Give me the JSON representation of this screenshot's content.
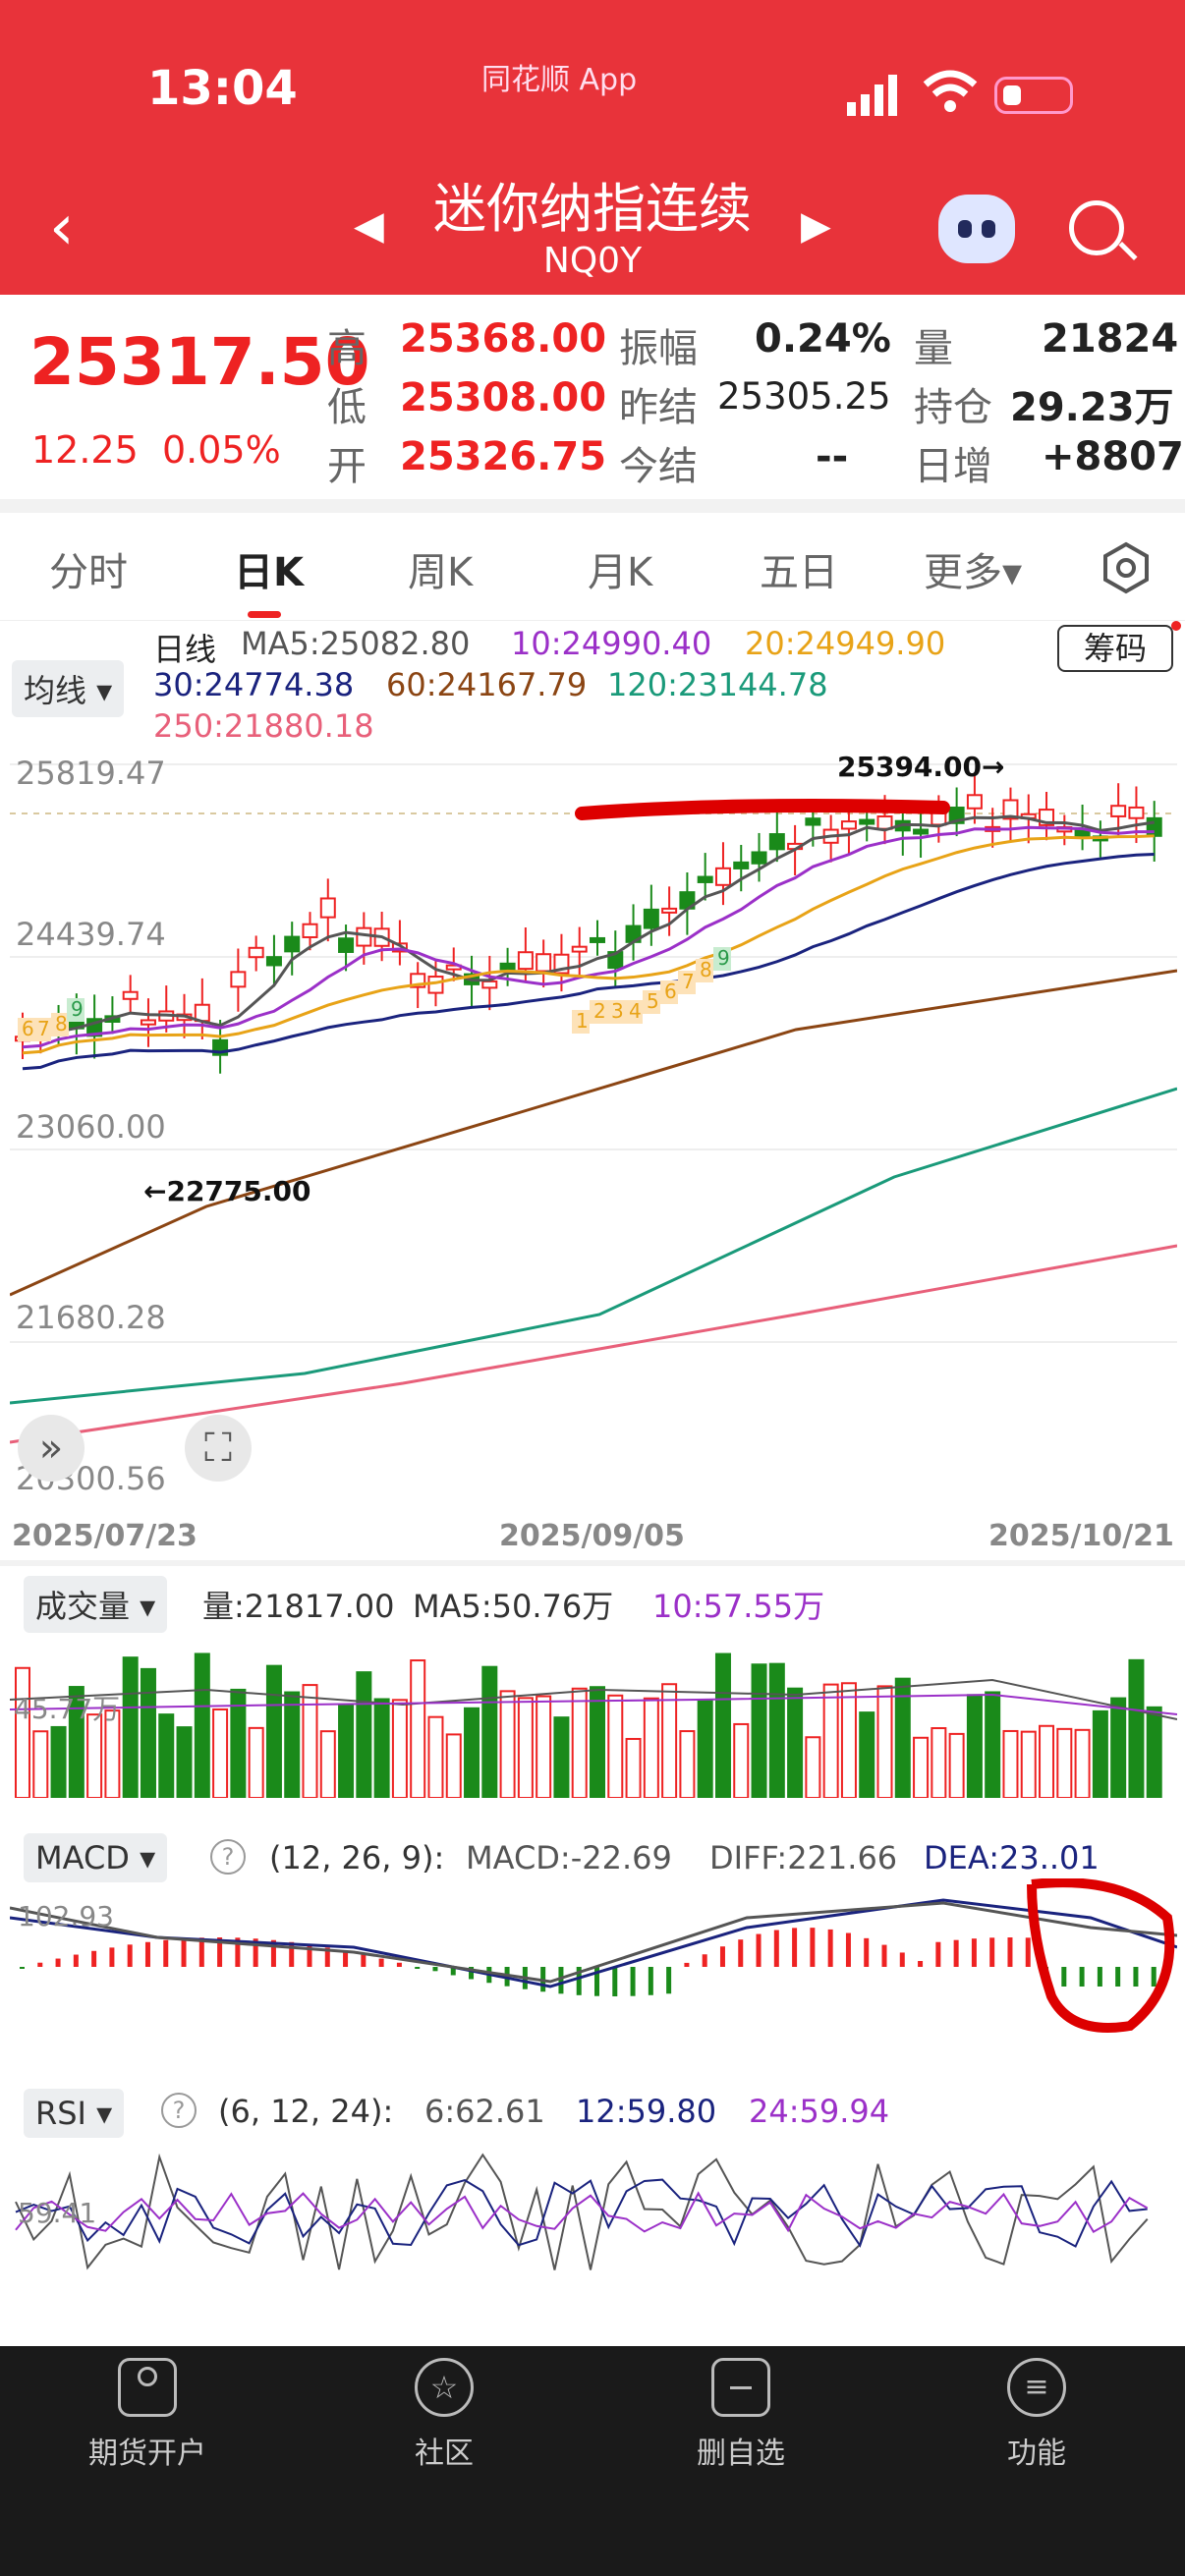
{
  "status_bar": {
    "time": "13:04",
    "app_badge": "同花顺 App"
  },
  "header": {
    "title": "迷你纳指连续",
    "code": "NQ0Y"
  },
  "quote": {
    "price": "25317.50",
    "change": "12.25",
    "change_pct": "0.05%",
    "high_label": "高",
    "high": "25368.00",
    "low_label": "低",
    "low": "25308.00",
    "open_label": "开",
    "open": "25326.75",
    "amp_label": "振幅",
    "amp": "0.24%",
    "prev_label": "昨结",
    "prev": "25305.25",
    "today_label": "今结",
    "today": "--",
    "vol_label": "量",
    "vol": "21824",
    "oi_label": "持仓",
    "oi": "29.23万",
    "daily_label": "日增",
    "daily": "+8807"
  },
  "tabs": [
    "分时",
    "日K",
    "周K",
    "月K",
    "五日",
    "更多▾"
  ],
  "active_tab": 1,
  "ma": {
    "dropdown": "均线 ▾",
    "chip": "筹码",
    "label": "日线",
    "ma5": "MA5:25082.80",
    "ma10": "10:24990.40",
    "ma20": "20:24949.90",
    "ma30": "30:24774.38",
    "ma60": "60:24167.79",
    "ma120": "120:23144.78",
    "ma250": "250:21880.18"
  },
  "price_axis": [
    "25819.47",
    "24439.74",
    "23060.00",
    "21680.28",
    "20300.56"
  ],
  "date_axis": [
    "2025/07/23",
    "2025/09/05",
    "2025/10/21"
  ],
  "annotations": {
    "high_mark": "25394.00→",
    "low_mark": "←22775.00"
  },
  "seq_numbers": [
    "6",
    "7",
    "8",
    "9",
    "1",
    "2",
    "3",
    "4",
    "5",
    "6",
    "7",
    "8",
    "9"
  ],
  "volume": {
    "dropdown": "成交量 ▾",
    "vol": "量:21817.00",
    "ma5": "MA5:50.76万",
    "ma10": "10:57.55万",
    "axis": "45.77万"
  },
  "macd": {
    "dropdown": "MACD ▾",
    "help": "?",
    "params": "(12, 26, 9):",
    "macd": "MACD:-22.69",
    "diff": "DIFF:221.66",
    "dea": "DEA:23..01",
    "axis": "102.93"
  },
  "rsi": {
    "dropdown": "RSI ▾",
    "help": "?",
    "params": "(6, 12, 24):",
    "r6": "6:62.61",
    "r12": "12:59.80",
    "r24": "24:59.94",
    "axis": "59.41"
  },
  "bottom_nav": [
    "期货开户",
    "社区",
    "删自选",
    "功能"
  ],
  "colors": {
    "header": "#e8333a",
    "up": "#e22",
    "down": "#1a8a1a",
    "ma5": "#555555",
    "ma10": "#9b30c8",
    "ma20": "#e8a317",
    "ma30": "#1a237e",
    "ma60": "#8b4513",
    "ma120": "#1a9a7a",
    "ma250": "#e8607a"
  }
}
